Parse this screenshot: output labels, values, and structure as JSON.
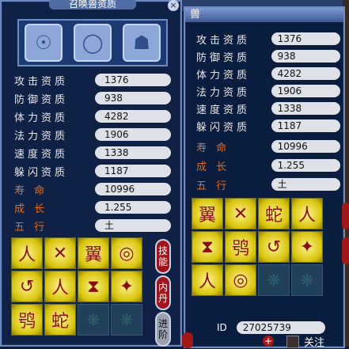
{
  "window_left": {
    "title": "召唤兽资质",
    "close_label": "×",
    "avatars": [
      "shoe-icon",
      "necklace-icon",
      "armor-icon"
    ],
    "stats": [
      {
        "label": "攻击资质",
        "value": "1376"
      },
      {
        "label": "防御资质",
        "value": "938"
      },
      {
        "label": "体力资质",
        "value": "4282"
      },
      {
        "label": "法力资质",
        "value": "1906"
      },
      {
        "label": "速度资质",
        "value": "1338"
      },
      {
        "label": "躲闪资质",
        "value": "1187"
      },
      {
        "label": "寿      命",
        "value": "10996"
      },
      {
        "label": "成      长",
        "value": "1.255"
      },
      {
        "label": "五      行",
        "value": "土"
      }
    ],
    "skill_icons": [
      "人",
      "✕",
      "翼",
      "◎",
      "↺",
      "人",
      "⧗",
      "✦",
      "鸮",
      "蛇",
      "",
      ""
    ],
    "side_buttons": [
      "技能",
      "内丹",
      "进阶"
    ]
  },
  "window_right": {
    "title": "兽",
    "stats": [
      {
        "label": "攻击资质",
        "value": "1376"
      },
      {
        "label": "防御资质",
        "value": "938"
      },
      {
        "label": "体力资质",
        "value": "4282"
      },
      {
        "label": "法力资质",
        "value": "1906"
      },
      {
        "label": "速度资质",
        "value": "1338"
      },
      {
        "label": "躲闪资质",
        "value": "1187"
      },
      {
        "label": "寿      命",
        "value": "10996"
      },
      {
        "label": "成      长",
        "value": "1.255"
      },
      {
        "label": "五      行",
        "value": "土"
      }
    ],
    "skill_icons": [
      "翼",
      "✕",
      "蛇",
      "人",
      "⧗",
      "鸮",
      "↺",
      "✦",
      "人",
      "◎",
      "",
      ""
    ],
    "id_label": "ID",
    "id_value": "27025739",
    "follow_label": "关注",
    "plus_label": "+"
  },
  "colors": {
    "highlight": "#e86b18",
    "accent": "#a0141e"
  }
}
